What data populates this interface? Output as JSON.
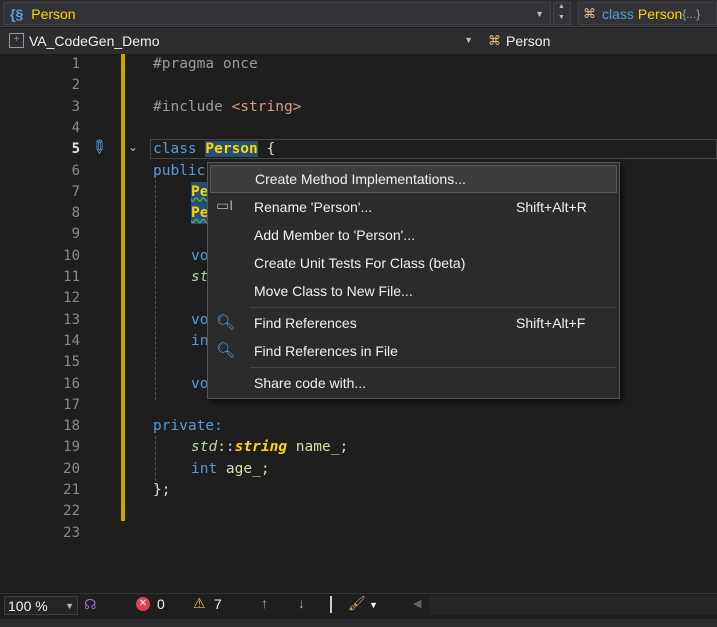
{
  "nav_bar": {
    "scope": "Person",
    "member_kw": "class",
    "member_name": "Person",
    "member_suffix": "{...}"
  },
  "project_bar": {
    "project": "VA_CodeGen_Demo",
    "symbol": "Person"
  },
  "line_numbers": [
    "1",
    "2",
    "3",
    "4",
    "5",
    "6",
    "7",
    "8",
    "9",
    "10",
    "11",
    "12",
    "13",
    "14",
    "15",
    "16",
    "17",
    "18",
    "19",
    "20",
    "21",
    "22",
    "23"
  ],
  "code": {
    "l1": "#pragma once",
    "l3a": "#include ",
    "l3b": "<string>",
    "l5a": "class ",
    "l5b": "Person",
    "l5c": " {",
    "l6": "public",
    "l7": "Pe",
    "l8": "Pe",
    "l10": "vo",
    "l11": "st",
    "l13": "vo",
    "l14": "in",
    "l16": "vo",
    "l18": "private:",
    "l19a": "std",
    "l19b": "::",
    "l19c": "string",
    "l19d": " name_;",
    "l20a": "int",
    "l20b": " age_;",
    "l21": "};"
  },
  "context_menu": {
    "items": [
      {
        "label": "Create Method Implementations...",
        "shortcut": ""
      },
      {
        "label": "Rename 'Person'...",
        "shortcut": "Shift+Alt+R"
      },
      {
        "label": "Add Member to 'Person'...",
        "shortcut": ""
      },
      {
        "label": "Create Unit Tests For Class (beta)",
        "shortcut": ""
      },
      {
        "label": "Move Class to New File...",
        "shortcut": ""
      },
      {
        "label": "Find References",
        "shortcut": "Shift+Alt+F"
      },
      {
        "label": "Find References in File",
        "shortcut": ""
      },
      {
        "label": "Share code with...",
        "shortcut": ""
      }
    ]
  },
  "status": {
    "zoom": "100 %",
    "errors": "0",
    "warnings": "7"
  },
  "colors": {
    "accent_yellow": "#ffd700",
    "keyword": "#569cd6",
    "background": "#1e1e1e"
  }
}
